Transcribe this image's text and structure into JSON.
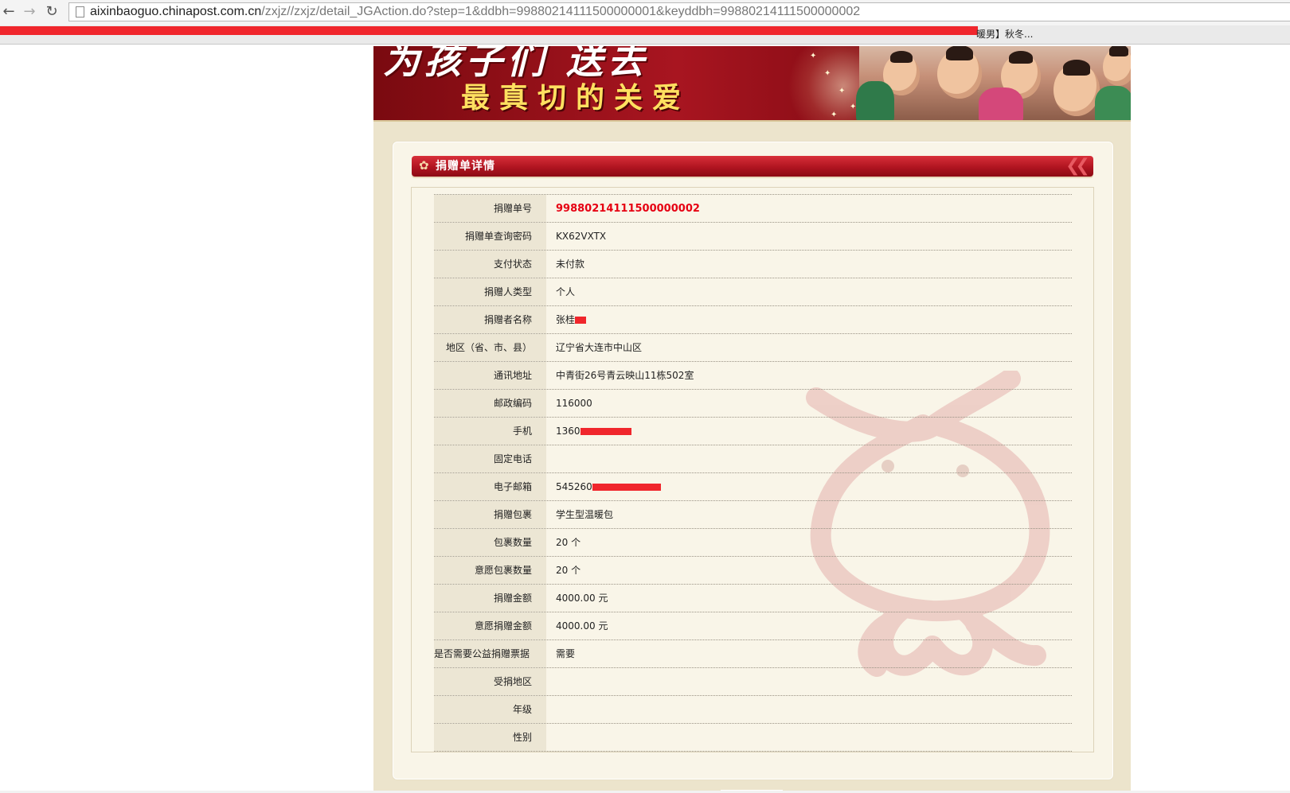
{
  "browser": {
    "back_icon": "back-arrow-icon",
    "forward_icon": "forward-arrow-icon",
    "reload_icon": "reload-icon",
    "url_host": "aixinbaoguo.chinapost.com.cn",
    "url_path": "/zxjz//zxjz/detail_JGAction.do?step=1&ddbh=99880214111500000001&keyddbh=99880214111500000002",
    "bookmark_tail": "暖男】秋冬..."
  },
  "banner": {
    "line1": "为孩子们 送去",
    "line2": "最真切的关爱"
  },
  "panel": {
    "title": "捐赠单详情"
  },
  "colors": {
    "accent_red": "#b01420",
    "highlight_red": "#e60012",
    "page_bg": "#ece4cc",
    "panel_bg": "#f9f5e8",
    "redaction": "#f0262c"
  },
  "rows": [
    {
      "label": "捐赠单号",
      "value": "99880214111500000002"
    },
    {
      "label": "捐赠单查询密码",
      "value": "KX62VXTX"
    },
    {
      "label": "支付状态",
      "value": "未付款"
    },
    {
      "label": "捐赠人类型",
      "value": "个人"
    },
    {
      "label": "捐赠者名称",
      "value": "张桂"
    },
    {
      "label": "地区（省、市、县）",
      "value": "辽宁省大连市中山区"
    },
    {
      "label": "通讯地址",
      "value": "中青街26号青云映山11栋502室"
    },
    {
      "label": "邮政编码",
      "value": "116000"
    },
    {
      "label": "手机",
      "value": "1360"
    },
    {
      "label": "固定电话",
      "value": ""
    },
    {
      "label": "电子邮箱",
      "value": "545260"
    },
    {
      "label": "捐赠包裹",
      "value": "学生型温暖包"
    },
    {
      "label": "包裹数量",
      "value": "20 个"
    },
    {
      "label": "意愿包裹数量",
      "value": "20 个"
    },
    {
      "label": "捐赠金额",
      "value": "4000.00 元"
    },
    {
      "label": "意愿捐赠金额",
      "value": "4000.00 元"
    },
    {
      "label": "是否需要公益捐赠票据",
      "value": "需要"
    },
    {
      "label": "受捐地区",
      "value": ""
    },
    {
      "label": "年级",
      "value": ""
    },
    {
      "label": "性别",
      "value": ""
    }
  ]
}
